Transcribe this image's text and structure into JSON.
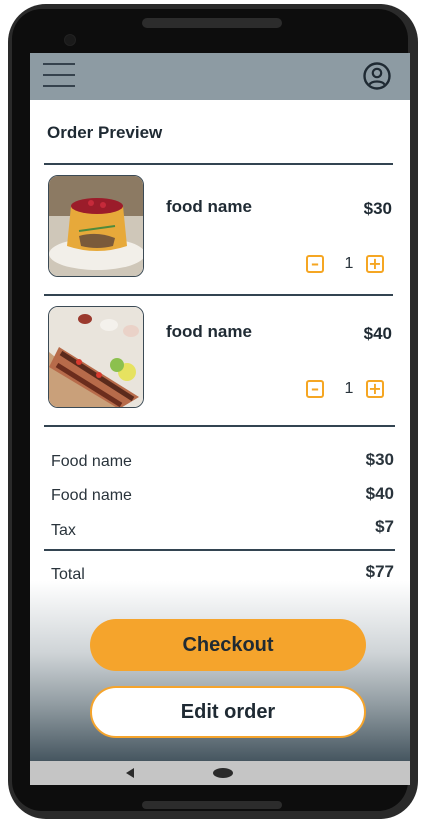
{
  "header": {
    "menu_icon": "hamburger-menu-icon",
    "profile_icon": "user-account-icon"
  },
  "page": {
    "title": "Order Preview"
  },
  "items": [
    {
      "name": "food name",
      "price": "$30",
      "quantity": "1",
      "image": "cake-food-photo"
    },
    {
      "name": "food name",
      "price": "$40",
      "quantity": "1",
      "image": "kebab-platter-photo"
    }
  ],
  "summary": {
    "lines": [
      {
        "label": "Food name",
        "value": "$30"
      },
      {
        "label": "Food name",
        "value": "$40"
      },
      {
        "label": "Tax",
        "value": "$7"
      }
    ],
    "total": {
      "label": "Total",
      "value": "$77"
    }
  },
  "actions": {
    "checkout": "Checkout",
    "edit": "Edit order"
  },
  "colors": {
    "accent": "#f5a42c",
    "appbar": "#8d9ba3",
    "text": "#1f2a33"
  }
}
